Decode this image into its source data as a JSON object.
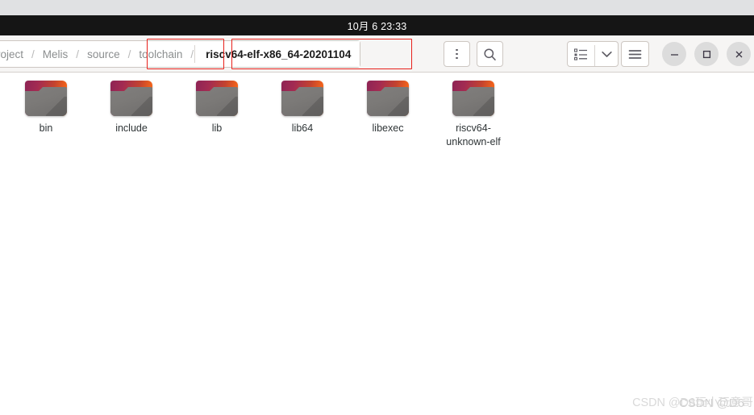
{
  "topbar": {
    "clock": "10月 6  23:33"
  },
  "headerbar": {
    "breadcrumb": {
      "items": [
        {
          "label": "roject",
          "current": false
        },
        {
          "label": "Melis",
          "current": false
        },
        {
          "label": "source",
          "current": false
        },
        {
          "label": "toolchain",
          "current": false
        },
        {
          "label": "riscv64-elf-x86_64-20201104",
          "current": true
        }
      ],
      "separator": "/"
    },
    "buttons": {
      "overflow_menu": "",
      "search": "",
      "view_list": "",
      "view_chevron": "",
      "main_menu": ""
    },
    "window_controls": {
      "minimize": "–",
      "maximize": "□",
      "close": "×"
    },
    "annotations": [
      {
        "target": "toolchain",
        "color": "#e8201b"
      },
      {
        "target": "riscv64-elf-x86_64-20201104",
        "color": "#e8201b"
      }
    ]
  },
  "files": {
    "items": [
      {
        "name": "bin",
        "type": "folder"
      },
      {
        "name": "include",
        "type": "folder"
      },
      {
        "name": "lib",
        "type": "folder"
      },
      {
        "name": "lib64",
        "type": "folder"
      },
      {
        "name": "libexec",
        "type": "folder"
      },
      {
        "name": "riscv64-unknown-elf",
        "type": "folder"
      }
    ]
  },
  "watermark": {
    "text_front": "CSDN @D6",
    "text_back": "CSDN @D6玩小玩意哥"
  },
  "colors": {
    "topbar_bg": "#151515",
    "headerbar_bg": "#f6f5f4",
    "content_bg": "#ffffff",
    "annotation_red": "#e8201b",
    "folder_tab_magenta": "#8e2455",
    "folder_tab_orange": "#fb7016",
    "folder_body_gray": "#7b7977",
    "label_text": "#2e3436",
    "breadcrumb_inactive": "#8b8e8f",
    "breadcrumb_active": "#1b1b1b"
  }
}
